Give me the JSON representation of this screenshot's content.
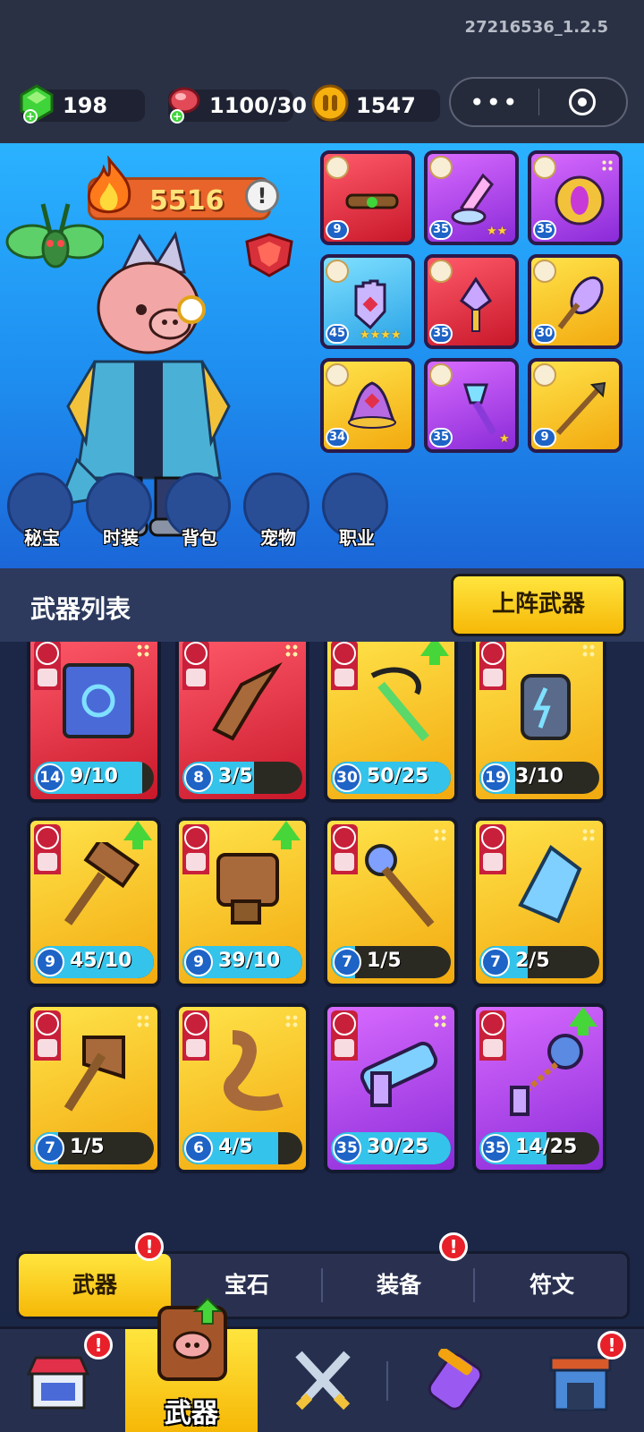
{
  "version": "27216536_1.2.5",
  "resources": {
    "gems": "198",
    "stamina": "1100/30",
    "coins": "1547"
  },
  "hero": {
    "power": "5516"
  },
  "equipment_slots": [
    {
      "level": "9",
      "color": "red",
      "stars": ""
    },
    {
      "level": "35",
      "color": "purple",
      "stars": "★★"
    },
    {
      "level": "35",
      "color": "purple",
      "stars": ""
    },
    {
      "level": "45",
      "color": "blue",
      "stars": "★★★★"
    },
    {
      "level": "35",
      "color": "red",
      "stars": ""
    },
    {
      "level": "30",
      "color": "yellow",
      "stars": ""
    },
    {
      "level": "34",
      "color": "yellow",
      "stars": ""
    },
    {
      "level": "35",
      "color": "purple",
      "stars": "★"
    },
    {
      "level": "9",
      "color": "yellow",
      "stars": ""
    }
  ],
  "features": [
    {
      "label": "秘宝",
      "icon": "treasure-pot-icon"
    },
    {
      "label": "时装",
      "icon": "hat-icon"
    },
    {
      "label": "背包",
      "icon": "robot-bag-icon"
    },
    {
      "label": "宠物",
      "icon": "paw-icon"
    },
    {
      "label": "职业",
      "icon": "sword-icon"
    }
  ],
  "weapon_list": {
    "title": "武器列表",
    "equip_button": "上阵武器",
    "weapons": [
      {
        "name": "spellbook",
        "level": "14",
        "count": "9/10",
        "color": "red",
        "fill": 0.9,
        "upgrade": false
      },
      {
        "name": "boomerang",
        "level": "8",
        "count": "3/5",
        "color": "red",
        "fill": 0.6,
        "upgrade": false
      },
      {
        "name": "scythe",
        "level": "30",
        "count": "50/25",
        "color": "yellow",
        "fill": 1.0,
        "upgrade": true
      },
      {
        "name": "battery",
        "level": "19",
        "count": "3/10",
        "color": "yellow",
        "fill": 0.3,
        "upgrade": false
      },
      {
        "name": "hammer",
        "level": "9",
        "count": "45/10",
        "color": "yellow",
        "fill": 1.0,
        "upgrade": true
      },
      {
        "name": "gauntlet",
        "level": "9",
        "count": "39/10",
        "color": "yellow",
        "fill": 1.0,
        "upgrade": true
      },
      {
        "name": "staff",
        "level": "7",
        "count": "1/5",
        "color": "yellow",
        "fill": 0.2,
        "upgrade": false
      },
      {
        "name": "crystal",
        "level": "7",
        "count": "2/5",
        "color": "yellow",
        "fill": 0.4,
        "upgrade": false
      },
      {
        "name": "axe",
        "level": "7",
        "count": "1/5",
        "color": "yellow",
        "fill": 0.2,
        "upgrade": false
      },
      {
        "name": "horn",
        "level": "6",
        "count": "4/5",
        "color": "yellow",
        "fill": 0.8,
        "upgrade": false
      },
      {
        "name": "blaster",
        "level": "35",
        "count": "30/25",
        "color": "purple",
        "fill": 1.0,
        "upgrade": false
      },
      {
        "name": "flail",
        "level": "35",
        "count": "14/25",
        "color": "purple",
        "fill": 0.56,
        "upgrade": true
      }
    ]
  },
  "sub_tabs": [
    {
      "label": "武器",
      "active": true,
      "alert": true
    },
    {
      "label": "宝石",
      "active": false,
      "alert": false
    },
    {
      "label": "装备",
      "active": false,
      "alert": true
    },
    {
      "label": "符文",
      "active": false,
      "alert": false
    }
  ],
  "bottom_nav": {
    "active_label": "武器"
  },
  "alert_mark": "!"
}
